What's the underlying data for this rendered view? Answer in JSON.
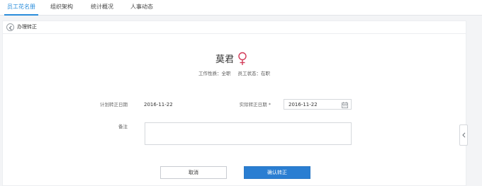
{
  "nav": {
    "tabs": [
      {
        "label": "员工花名册",
        "active": true
      },
      {
        "label": "组织架构",
        "active": false
      },
      {
        "label": "统计概况",
        "active": false
      },
      {
        "label": "人事动态",
        "active": false
      }
    ]
  },
  "page": {
    "back_label": "办理转正"
  },
  "employee": {
    "name": "莫君",
    "gender_icon": "female-icon",
    "work_type": "工作性质：全职",
    "status": "员工状态：在职"
  },
  "form": {
    "planned_label": "计划转正日期",
    "planned_value": "2016-11-22",
    "actual_label": "实际转正日期 *",
    "actual_value": "2016-11-22",
    "remark_label": "备注",
    "remark_value": ""
  },
  "actions": {
    "cancel_label": "取消",
    "confirm_label": "确认转正"
  },
  "colors": {
    "accent": "#2a8ddb",
    "primary_button": "#2a7ed2",
    "female_icon": "#d23a58"
  },
  "icons": {
    "back": "chevron-left-circle-icon",
    "calendar": "calendar-icon",
    "side_toggle": "chevron-left-icon"
  }
}
